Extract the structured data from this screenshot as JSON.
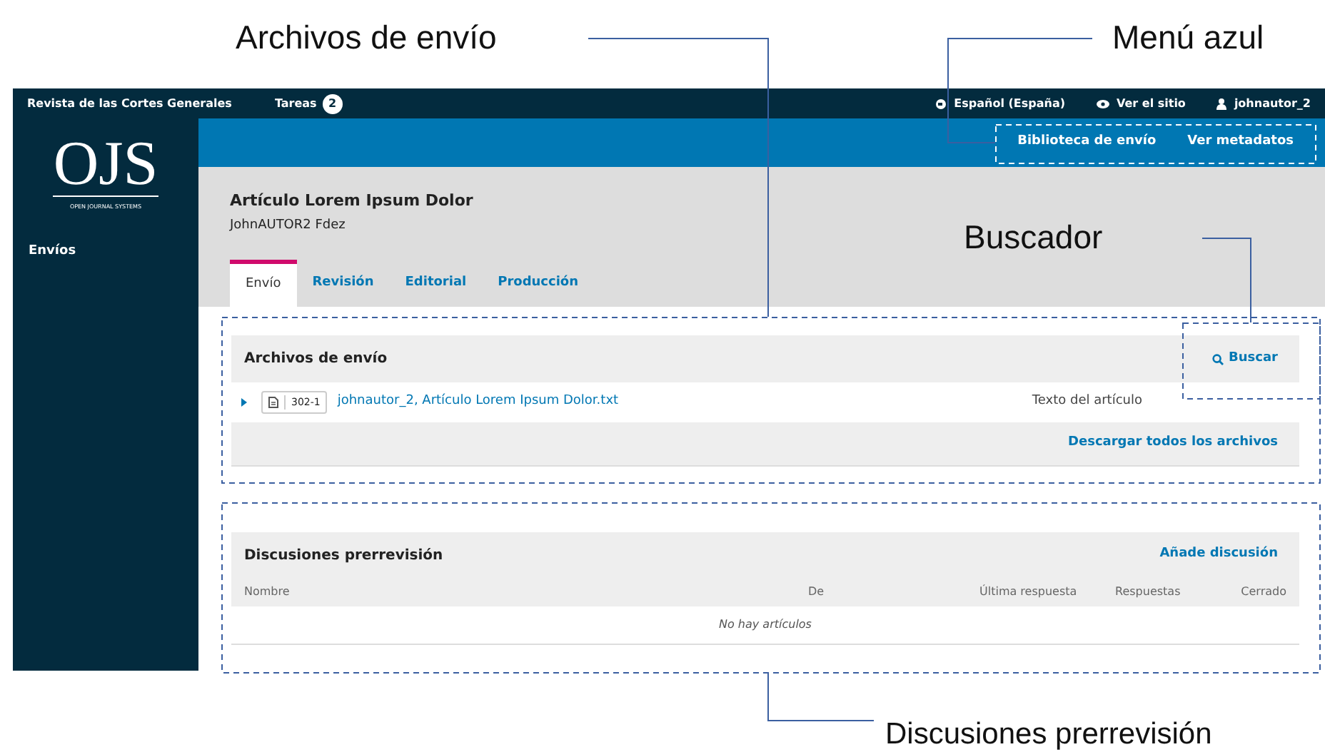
{
  "annotations": {
    "files": "Archivos de envío",
    "menu": "Menú azul",
    "search": "Buscador",
    "discussions": "Discusiones prerrevisión"
  },
  "top_bar": {
    "site": "Revista de las Cortes Generales",
    "tasks": "Tareas",
    "tasks_count": "2",
    "language": "Español (España)",
    "view_site": "Ver el sitio",
    "user": "johnautor_2"
  },
  "sidebar": {
    "logo": "OJS",
    "logo_subtitle": "OPEN JOURNAL SYSTEMS",
    "items": [
      {
        "label": "Envíos"
      }
    ]
  },
  "blue_menu": [
    "Biblioteca de envío",
    "Ver metadatos"
  ],
  "submission": {
    "title": "Artículo Lorem Ipsum Dolor",
    "author": "JohnAUTOR2 Fdez"
  },
  "tabs": [
    {
      "label": "Envío",
      "selected": true
    },
    {
      "label": "Revisión",
      "selected": false
    },
    {
      "label": "Editorial",
      "selected": false
    },
    {
      "label": "Producción",
      "selected": false
    }
  ],
  "files_panel": {
    "title": "Archivos de envío",
    "search": "Buscar",
    "rows": [
      {
        "id": "302-1",
        "name": "johnautor_2, Artículo Lorem Ipsum Dolor.txt",
        "type": "Texto del artículo"
      }
    ],
    "download_all": "Descargar todos los archivos"
  },
  "discussions_panel": {
    "title": "Discusiones prerrevisión",
    "add": "Añade discusión",
    "columns": [
      "Nombre",
      "De",
      "Última respuesta",
      "Respuestas",
      "Cerrado"
    ],
    "empty": "No hay artículos"
  }
}
